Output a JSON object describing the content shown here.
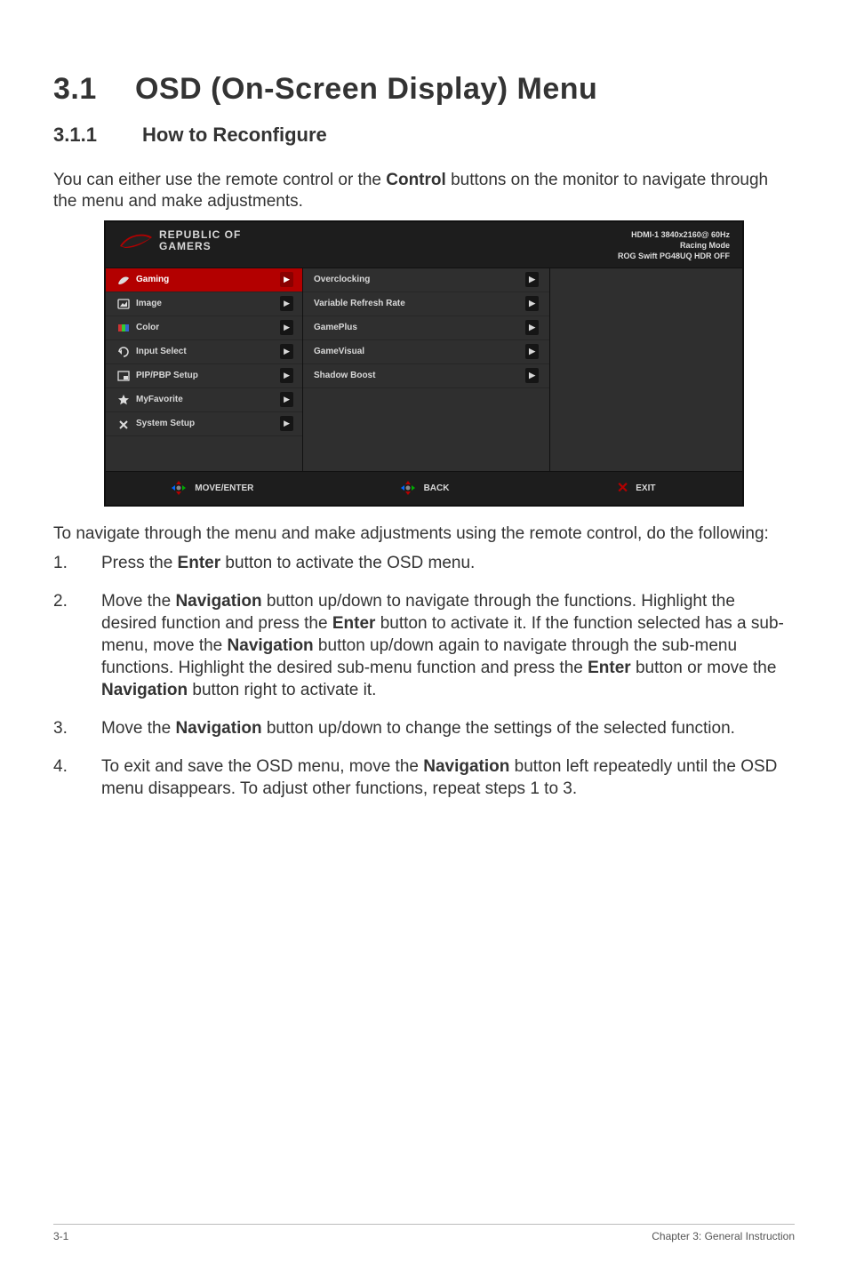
{
  "heading": {
    "number": "3.1",
    "title": "OSD (On-Screen Display) Menu"
  },
  "subheading": {
    "number": "3.1.1",
    "title": "How to Reconfigure"
  },
  "intro": {
    "part1": "You can either use the remote control or the ",
    "bold1": "Control",
    "part2": " buttons on the monitor to navigate through the menu and make adjustments."
  },
  "osd": {
    "logo_line1": "REPUBLIC OF",
    "logo_line2": "GAMERS",
    "status_line1": "HDMI-1  3840x2160@  60Hz",
    "status_line2": "Racing Mode",
    "status_line3": "ROG Swift  PG48UQ  HDR OFF",
    "left_items": [
      {
        "label": "Gaming",
        "selected": true,
        "icon": "rog"
      },
      {
        "label": "Image",
        "selected": false,
        "icon": "image"
      },
      {
        "label": "Color",
        "selected": false,
        "icon": "color"
      },
      {
        "label": "Input Select",
        "selected": false,
        "icon": "input"
      },
      {
        "label": "PIP/PBP Setup",
        "selected": false,
        "icon": "pip"
      },
      {
        "label": "MyFavorite",
        "selected": false,
        "icon": "star"
      },
      {
        "label": "System Setup",
        "selected": false,
        "icon": "tools"
      }
    ],
    "mid_items": [
      "Overclocking",
      "Variable Refresh Rate",
      "GamePlus",
      "GameVisual",
      "Shadow Boost"
    ],
    "footer": {
      "move": "MOVE/ENTER",
      "back": "BACK",
      "exit": "EXIT"
    }
  },
  "after_osd": "To navigate through the menu and make adjustments using the remote control, do the following:",
  "steps": [
    {
      "num": "1.",
      "segments": [
        {
          "t": "Press the "
        },
        {
          "t": "Enter",
          "b": true
        },
        {
          "t": " button to activate the OSD menu."
        }
      ]
    },
    {
      "num": "2.",
      "segments": [
        {
          "t": "Move the "
        },
        {
          "t": "Navigation",
          "b": true
        },
        {
          "t": " button up/down to navigate through the functions. Highlight the desired function and press the "
        },
        {
          "t": "Enter",
          "b": true
        },
        {
          "t": " button to activate it. If the function selected has a sub-menu, move the "
        },
        {
          "t": "Navigation",
          "b": true
        },
        {
          "t": " button up/down again to navigate through the sub-menu functions. Highlight the desired sub-menu function and press the "
        },
        {
          "t": "Enter",
          "b": true
        },
        {
          "t": " button or move the "
        },
        {
          "t": "Navigation",
          "b": true
        },
        {
          "t": " button right to activate it."
        }
      ]
    },
    {
      "num": "3.",
      "segments": [
        {
          "t": "Move the "
        },
        {
          "t": "Navigation",
          "b": true
        },
        {
          "t": " button up/down to change the settings of the selected function."
        }
      ]
    },
    {
      "num": "4.",
      "segments": [
        {
          "t": "To exit and save the OSD menu, move the "
        },
        {
          "t": "Navigation",
          "b": true
        },
        {
          "t": " button left repeatedly until the OSD menu disappears. To adjust other functions, repeat steps 1 to 3."
        }
      ]
    }
  ],
  "footer_left": "3-1",
  "footer_right": "Chapter 3: General Instruction"
}
